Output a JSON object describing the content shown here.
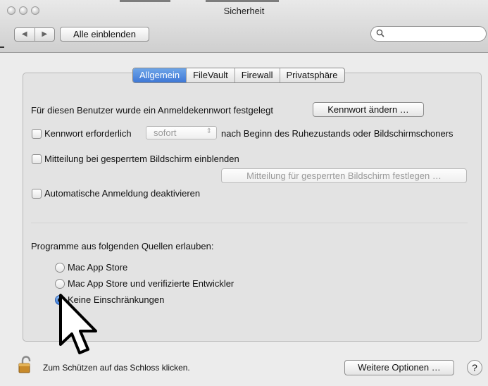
{
  "window": {
    "title": "Sicherheit"
  },
  "toolbar": {
    "back_icon": "◀",
    "forward_icon": "▶",
    "show_all_label": "Alle einblenden",
    "search_icon": "🔍",
    "search_placeholder": ""
  },
  "tabs": [
    {
      "label": "Allgemein",
      "active": true
    },
    {
      "label": "FileVault",
      "active": false
    },
    {
      "label": "Firewall",
      "active": false
    },
    {
      "label": "Privatsphäre",
      "active": false
    }
  ],
  "general": {
    "password_set_text": "Für diesen Benutzer wurde ein Anmeldekennwort festgelegt",
    "change_password_button": "Kennwort ändern …",
    "require_password_label": "Kennwort erforderlich",
    "require_password_checked": false,
    "require_password_delay": "sofort",
    "dropdown_arrow": "⇕",
    "require_password_suffix": "nach Beginn des Ruhezustands oder Bildschirmschoners",
    "lock_message_label": "Mitteilung bei gesperrtem Bildschirm einblenden",
    "lock_message_checked": false,
    "lock_message_button": "Mitteilung für gesperrten Bildschirm festlegen …",
    "auto_login_label": "Automatische Anmeldung deaktivieren",
    "auto_login_checked": false
  },
  "sources": {
    "heading": "Programme aus folgenden Quellen erlauben:",
    "options": [
      {
        "label": "Mac App Store",
        "selected": false
      },
      {
        "label": "Mac App Store und verifizierte Entwickler",
        "selected": false
      },
      {
        "label": "Keine Einschränkungen",
        "selected": true
      }
    ]
  },
  "footer": {
    "lock_text": "Zum Schützen auf das Schloss klicken.",
    "more_options_button": "Weitere Optionen …",
    "help_label": "?"
  },
  "colors": {
    "accent": "#3f78d6",
    "panel": "#e3e3e3",
    "window": "#ececec"
  }
}
